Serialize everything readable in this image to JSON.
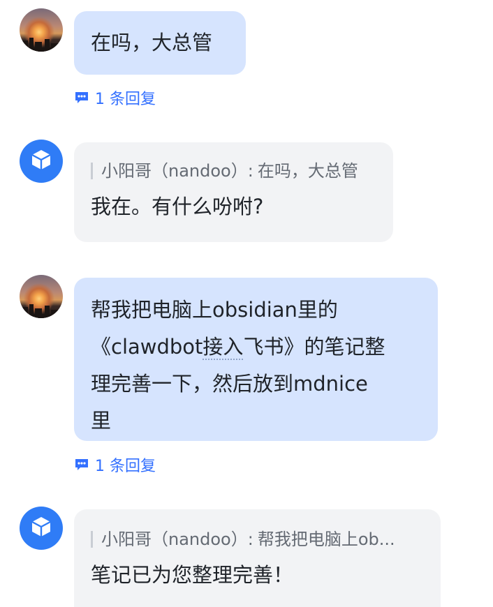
{
  "messages": [
    {
      "sender": "user",
      "text": "在吗，大总管",
      "reply_link": "1 条回复"
    },
    {
      "sender": "bot",
      "quote_author": "小阳哥（nandoo）",
      "quote_text": "在吗，大总管",
      "text": "我在。有什么吩咐?"
    },
    {
      "sender": "user",
      "text_line1": "帮我把电脑上obsidian里的",
      "text_line2_pre": "《clawdbot",
      "text_line2_link": "接入",
      "text_line2_post": "飞书》的笔记整",
      "text_line3": "理完善一下，然后放到mdnice",
      "text_line4": "里",
      "reply_link": "1 条回复"
    },
    {
      "sender": "bot",
      "quote_author": "小阳哥（nandoo）",
      "quote_text": "帮我把电脑上ob...",
      "text": "笔记已为您整理完善！"
    }
  ],
  "colors": {
    "user_bubble": "#d6e4fe",
    "bot_bubble": "#f2f3f5",
    "link": "#3370ff",
    "bot_avatar": "#2f7cf6"
  },
  "icons": {
    "reply": "comment-icon",
    "bot_avatar": "cube-icon"
  }
}
